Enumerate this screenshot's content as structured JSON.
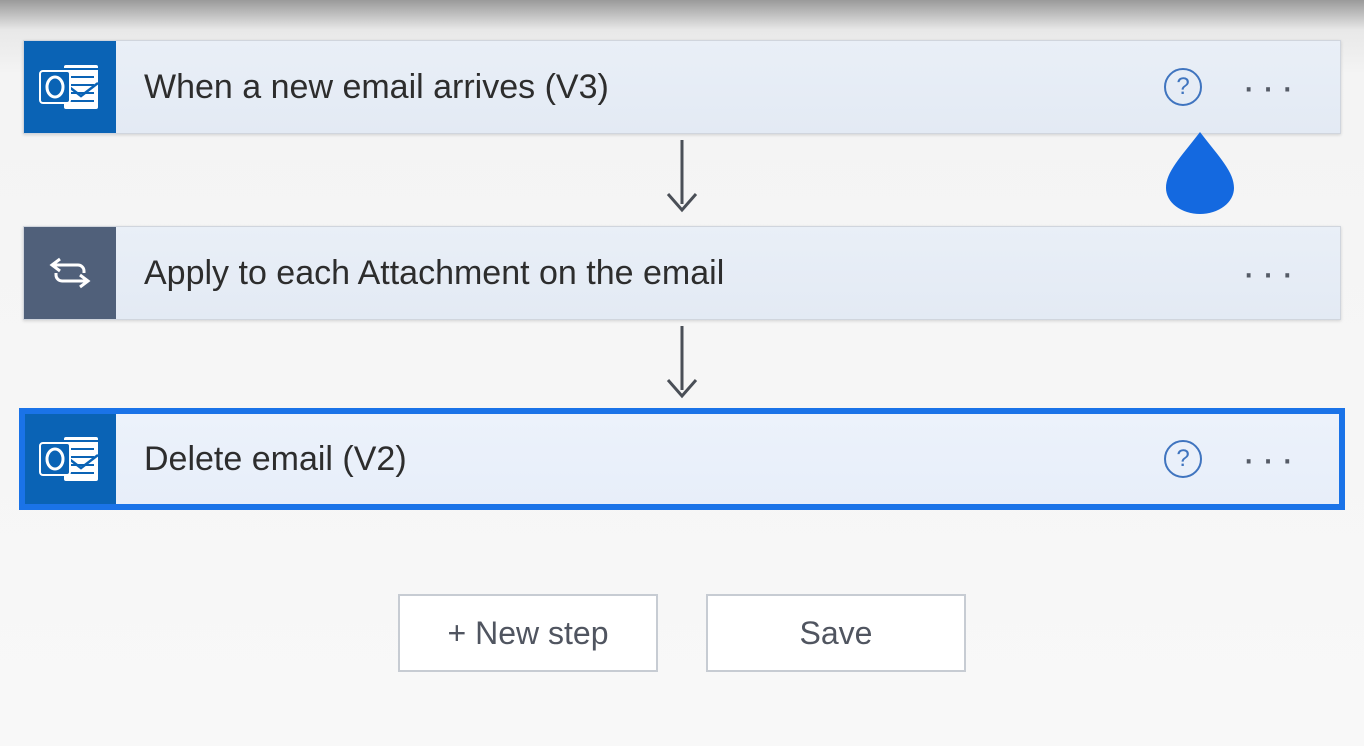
{
  "steps": [
    {
      "type": "outlook",
      "title": "When a new email arrives (V3)",
      "hasHelp": true
    },
    {
      "type": "loop",
      "title": "Apply to each Attachment on the email",
      "hasHelp": false
    },
    {
      "type": "outlook",
      "title": "Delete email (V2)",
      "hasHelp": true,
      "selected": true
    }
  ],
  "buttons": {
    "newStep": "+ New step",
    "save": "Save"
  },
  "helpGlyph": "?"
}
